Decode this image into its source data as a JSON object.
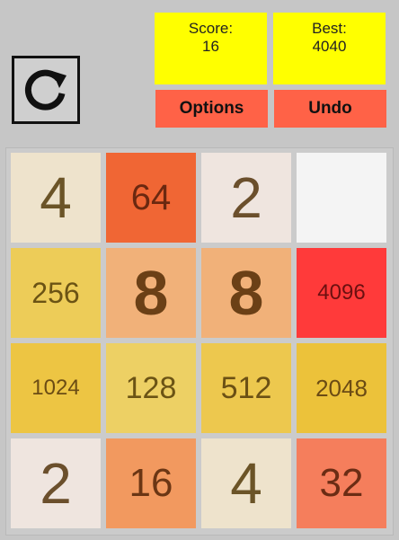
{
  "header": {
    "restart_icon": "restart-icon",
    "score_label": "Score:",
    "score_value": "16",
    "best_label": "Best:",
    "best_value": "4040",
    "options_label": "Options",
    "undo_label": "Undo"
  },
  "colors": {
    "score_box": "#ffff00",
    "buttons": "#ff6247",
    "background": "#c6c6c6"
  },
  "board": {
    "rows": [
      [
        "4",
        "64",
        "2",
        ""
      ],
      [
        "256",
        "8",
        "8",
        "4096"
      ],
      [
        "1024",
        "128",
        "512",
        "2048"
      ],
      [
        "2",
        "16",
        "4",
        "32"
      ]
    ]
  }
}
